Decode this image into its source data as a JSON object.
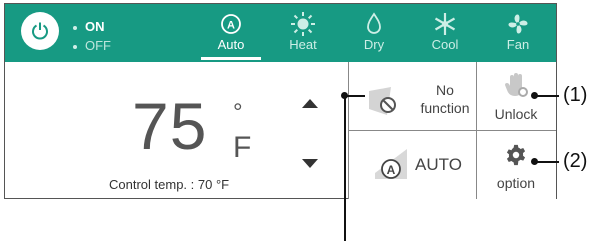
{
  "power": {
    "on_label": "ON",
    "off_label": "OFF"
  },
  "modes": [
    {
      "label": "Auto",
      "icon": "auto-mode-icon"
    },
    {
      "label": "Heat",
      "icon": "sun-icon"
    },
    {
      "label": "Dry",
      "icon": "droplet-icon"
    },
    {
      "label": "Cool",
      "icon": "snowflake-icon"
    },
    {
      "label": "Fan",
      "icon": "fan-icon"
    }
  ],
  "temperature": {
    "value": "75",
    "degree": "°",
    "unit": "F",
    "control_text": "Control temp. : 70 °F"
  },
  "buttons": {
    "no_function_line1": "No",
    "no_function_line2": "function",
    "unlock": "Unlock",
    "auto": "AUTO",
    "option": "option"
  },
  "callouts": {
    "first": "(1)",
    "second": "(2)"
  },
  "colors": {
    "topbar": "#179a83"
  }
}
